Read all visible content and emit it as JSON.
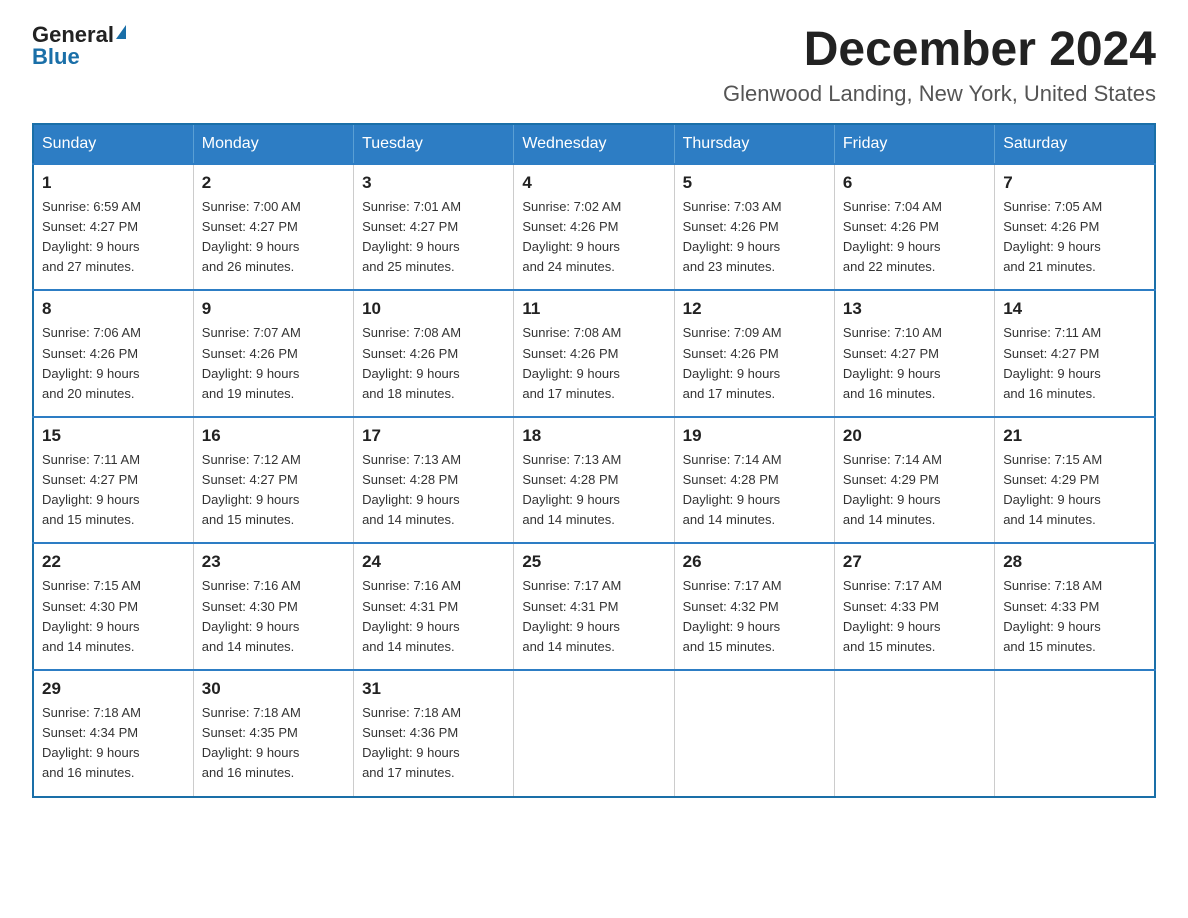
{
  "header": {
    "logo_general": "General",
    "logo_blue": "Blue",
    "month_title": "December 2024",
    "location": "Glenwood Landing, New York, United States"
  },
  "days_of_week": [
    "Sunday",
    "Monday",
    "Tuesday",
    "Wednesday",
    "Thursday",
    "Friday",
    "Saturday"
  ],
  "weeks": [
    [
      {
        "num": "1",
        "sunrise": "6:59 AM",
        "sunset": "4:27 PM",
        "daylight": "9 hours and 27 minutes."
      },
      {
        "num": "2",
        "sunrise": "7:00 AM",
        "sunset": "4:27 PM",
        "daylight": "9 hours and 26 minutes."
      },
      {
        "num": "3",
        "sunrise": "7:01 AM",
        "sunset": "4:27 PM",
        "daylight": "9 hours and 25 minutes."
      },
      {
        "num": "4",
        "sunrise": "7:02 AM",
        "sunset": "4:26 PM",
        "daylight": "9 hours and 24 minutes."
      },
      {
        "num": "5",
        "sunrise": "7:03 AM",
        "sunset": "4:26 PM",
        "daylight": "9 hours and 23 minutes."
      },
      {
        "num": "6",
        "sunrise": "7:04 AM",
        "sunset": "4:26 PM",
        "daylight": "9 hours and 22 minutes."
      },
      {
        "num": "7",
        "sunrise": "7:05 AM",
        "sunset": "4:26 PM",
        "daylight": "9 hours and 21 minutes."
      }
    ],
    [
      {
        "num": "8",
        "sunrise": "7:06 AM",
        "sunset": "4:26 PM",
        "daylight": "9 hours and 20 minutes."
      },
      {
        "num": "9",
        "sunrise": "7:07 AM",
        "sunset": "4:26 PM",
        "daylight": "9 hours and 19 minutes."
      },
      {
        "num": "10",
        "sunrise": "7:08 AM",
        "sunset": "4:26 PM",
        "daylight": "9 hours and 18 minutes."
      },
      {
        "num": "11",
        "sunrise": "7:08 AM",
        "sunset": "4:26 PM",
        "daylight": "9 hours and 17 minutes."
      },
      {
        "num": "12",
        "sunrise": "7:09 AM",
        "sunset": "4:26 PM",
        "daylight": "9 hours and 17 minutes."
      },
      {
        "num": "13",
        "sunrise": "7:10 AM",
        "sunset": "4:27 PM",
        "daylight": "9 hours and 16 minutes."
      },
      {
        "num": "14",
        "sunrise": "7:11 AM",
        "sunset": "4:27 PM",
        "daylight": "9 hours and 16 minutes."
      }
    ],
    [
      {
        "num": "15",
        "sunrise": "7:11 AM",
        "sunset": "4:27 PM",
        "daylight": "9 hours and 15 minutes."
      },
      {
        "num": "16",
        "sunrise": "7:12 AM",
        "sunset": "4:27 PM",
        "daylight": "9 hours and 15 minutes."
      },
      {
        "num": "17",
        "sunrise": "7:13 AM",
        "sunset": "4:28 PM",
        "daylight": "9 hours and 14 minutes."
      },
      {
        "num": "18",
        "sunrise": "7:13 AM",
        "sunset": "4:28 PM",
        "daylight": "9 hours and 14 minutes."
      },
      {
        "num": "19",
        "sunrise": "7:14 AM",
        "sunset": "4:28 PM",
        "daylight": "9 hours and 14 minutes."
      },
      {
        "num": "20",
        "sunrise": "7:14 AM",
        "sunset": "4:29 PM",
        "daylight": "9 hours and 14 minutes."
      },
      {
        "num": "21",
        "sunrise": "7:15 AM",
        "sunset": "4:29 PM",
        "daylight": "9 hours and 14 minutes."
      }
    ],
    [
      {
        "num": "22",
        "sunrise": "7:15 AM",
        "sunset": "4:30 PM",
        "daylight": "9 hours and 14 minutes."
      },
      {
        "num": "23",
        "sunrise": "7:16 AM",
        "sunset": "4:30 PM",
        "daylight": "9 hours and 14 minutes."
      },
      {
        "num": "24",
        "sunrise": "7:16 AM",
        "sunset": "4:31 PM",
        "daylight": "9 hours and 14 minutes."
      },
      {
        "num": "25",
        "sunrise": "7:17 AM",
        "sunset": "4:31 PM",
        "daylight": "9 hours and 14 minutes."
      },
      {
        "num": "26",
        "sunrise": "7:17 AM",
        "sunset": "4:32 PM",
        "daylight": "9 hours and 15 minutes."
      },
      {
        "num": "27",
        "sunrise": "7:17 AM",
        "sunset": "4:33 PM",
        "daylight": "9 hours and 15 minutes."
      },
      {
        "num": "28",
        "sunrise": "7:18 AM",
        "sunset": "4:33 PM",
        "daylight": "9 hours and 15 minutes."
      }
    ],
    [
      {
        "num": "29",
        "sunrise": "7:18 AM",
        "sunset": "4:34 PM",
        "daylight": "9 hours and 16 minutes."
      },
      {
        "num": "30",
        "sunrise": "7:18 AM",
        "sunset": "4:35 PM",
        "daylight": "9 hours and 16 minutes."
      },
      {
        "num": "31",
        "sunrise": "7:18 AM",
        "sunset": "4:36 PM",
        "daylight": "9 hours and 17 minutes."
      },
      null,
      null,
      null,
      null
    ]
  ],
  "labels": {
    "sunrise": "Sunrise:",
    "sunset": "Sunset:",
    "daylight": "Daylight:"
  }
}
